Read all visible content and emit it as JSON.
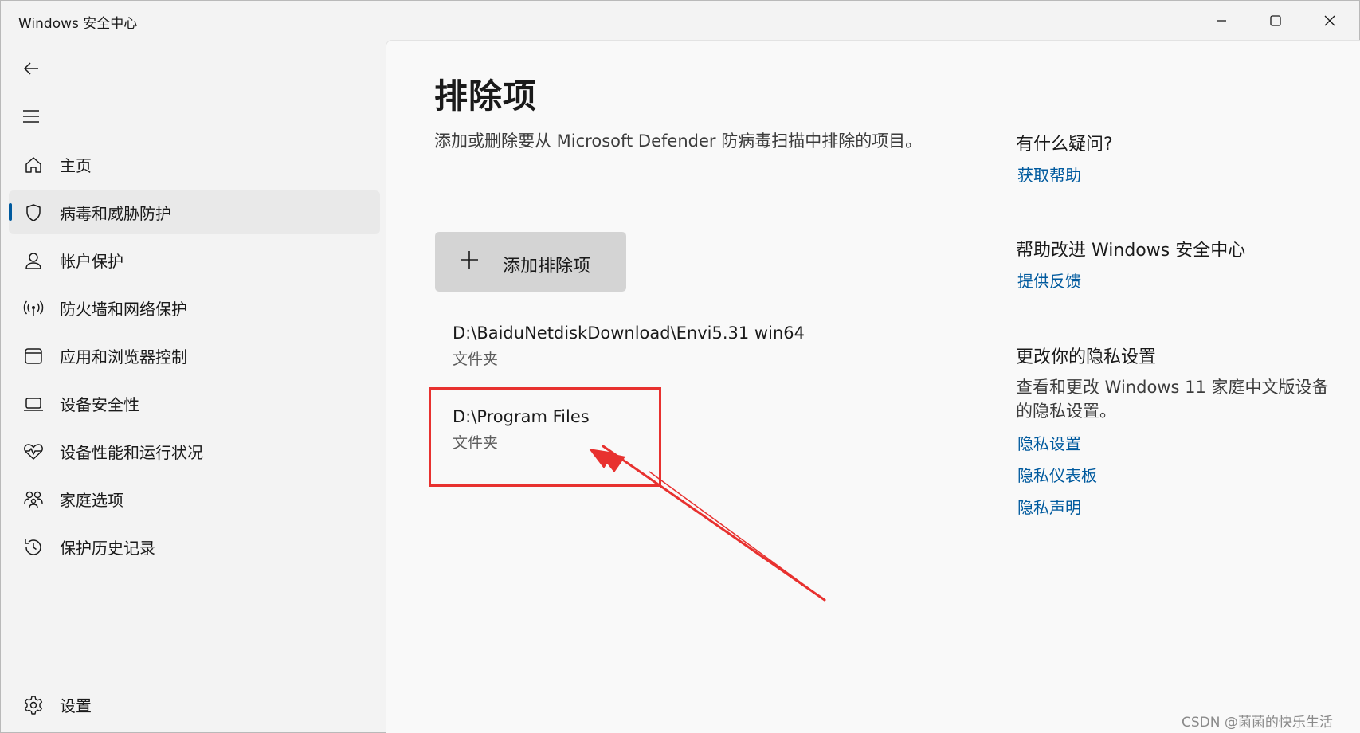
{
  "window": {
    "title": "Windows 安全中心",
    "minimize_icon": "minimize-icon",
    "maximize_icon": "maximize-icon",
    "close_icon": "close-icon"
  },
  "sidebar": {
    "back_icon": "back-arrow-icon",
    "menu_icon": "hamburger-menu-icon",
    "items": [
      {
        "label": "主页",
        "icon": "home-icon"
      },
      {
        "label": "病毒和威胁防护",
        "icon": "shield-icon",
        "active": true
      },
      {
        "label": "帐户保护",
        "icon": "person-icon"
      },
      {
        "label": "防火墙和网络保护",
        "icon": "wireless-icon"
      },
      {
        "label": "应用和浏览器控制",
        "icon": "browser-window-icon"
      },
      {
        "label": "设备安全性",
        "icon": "laptop-icon"
      },
      {
        "label": "设备性能和运行状况",
        "icon": "heart-pulse-icon"
      },
      {
        "label": "家庭选项",
        "icon": "family-icon"
      },
      {
        "label": "保护历史记录",
        "icon": "history-icon"
      }
    ],
    "settings": {
      "label": "设置",
      "icon": "gear-icon"
    }
  },
  "main": {
    "title": "排除项",
    "description": "添加或删除要从 Microsoft Defender 防病毒扫描中排除的项目。",
    "add_button": {
      "label": "添加排除项",
      "icon": "plus-icon"
    },
    "exclusions": [
      {
        "path": "D:\\BaiduNetdiskDownload\\Envi5.31 win64",
        "type": "文件夹"
      },
      {
        "path": "D:\\Program Files",
        "type": "文件夹"
      }
    ]
  },
  "aside": {
    "help_heading": "有什么疑问?",
    "help_link": "获取帮助",
    "improve_heading": "帮助改进 Windows 安全中心",
    "feedback_link": "提供反馈",
    "privacy_heading": "更改你的隐私设置",
    "privacy_text": "查看和更改 Windows 11 家庭中文版设备的隐私设置。",
    "privacy_links": [
      "隐私设置",
      "隐私仪表板",
      "隐私声明"
    ]
  },
  "annotation": {
    "color": "#e8312f"
  },
  "watermark": "CSDN @菌菌的快乐生活",
  "colors": {
    "accent": "#005a9e",
    "highlight": "#e8312f"
  }
}
